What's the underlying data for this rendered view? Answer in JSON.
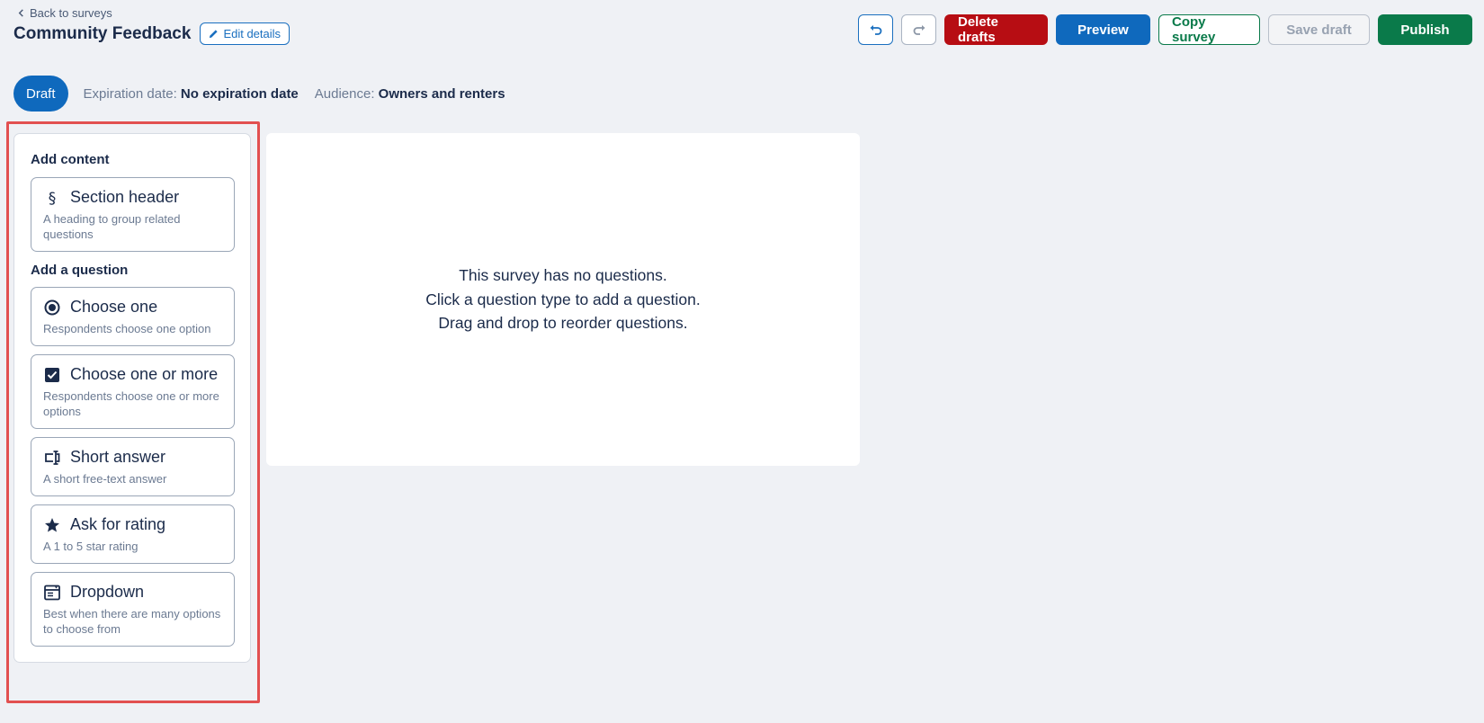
{
  "header": {
    "back_label": "Back to surveys",
    "title": "Community Feedback",
    "edit_label": "Edit details"
  },
  "toolbar": {
    "undo_icon": "undo-icon",
    "redo_icon": "redo-icon",
    "delete_label": "Delete drafts",
    "preview_label": "Preview",
    "copy_label": "Copy survey",
    "save_label": "Save draft",
    "publish_label": "Publish"
  },
  "status": {
    "pill": "Draft",
    "expiration_label": "Expiration date:",
    "expiration_value": "No expiration date",
    "audience_label": "Audience:",
    "audience_value": "Owners and renters"
  },
  "sidebar": {
    "content_heading": "Add content",
    "question_heading": "Add a question",
    "content_items": [
      {
        "icon": "section-icon",
        "title": "Section header",
        "desc": "A heading to group related questions"
      }
    ],
    "question_items": [
      {
        "icon": "radio-icon",
        "title": "Choose one",
        "desc": "Respondents choose one option"
      },
      {
        "icon": "checkbox-icon",
        "title": "Choose one or more",
        "desc": "Respondents choose one or more options"
      },
      {
        "icon": "text-cursor-icon",
        "title": "Short answer",
        "desc": "A short free-text answer"
      },
      {
        "icon": "star-icon",
        "title": "Ask for rating",
        "desc": "A 1 to 5 star rating"
      },
      {
        "icon": "dropdown-icon",
        "title": "Dropdown",
        "desc": "Best when there are many options to choose from"
      }
    ]
  },
  "canvas": {
    "empty_lines": [
      "This survey has no questions.",
      "Click a question type to add a question.",
      "Drag and drop to reorder questions."
    ]
  },
  "colors": {
    "primary": "#0f69bd",
    "danger": "#b70d13",
    "success": "#0a7a4a",
    "highlight": "#e25050"
  }
}
